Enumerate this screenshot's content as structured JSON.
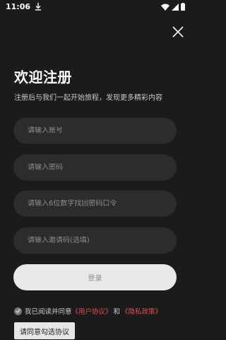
{
  "status_bar": {
    "time": "11:06",
    "icons": [
      "download-icon",
      "wifi-icon",
      "cellular-signal-icon",
      "battery-icon"
    ]
  },
  "header": {
    "close_icon": "close-icon",
    "title": "欢迎注册",
    "subtitle": "注册后与我们一起开始旅程，发现更多精彩内容"
  },
  "form": {
    "account_placeholder": "请输入账号",
    "password_placeholder": "请输入密码",
    "recovery_code_placeholder": "请输入6位数字找回密码口令",
    "invite_code_placeholder": "请输入邀请码(选填)",
    "submit_label": "登录"
  },
  "agreement": {
    "prefix": "我已阅读并同意",
    "user_agreement": "《用户协议》",
    "and": "和",
    "privacy_policy": "《隐私政策》",
    "link_color": "#e05050"
  },
  "toast": {
    "message": "请同意勾选协议"
  },
  "colors": {
    "background": "#1b1b1b",
    "field_background": "#2c2c2c",
    "button_background": "#e8e8e8"
  }
}
